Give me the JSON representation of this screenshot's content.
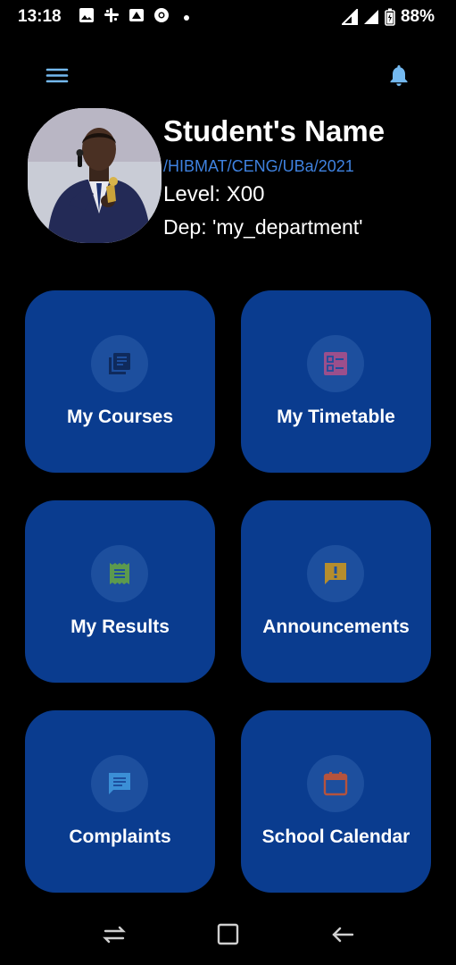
{
  "status_bar": {
    "time": "13:18",
    "battery": "88%",
    "left_icons": [
      "image-icon",
      "slack-icon",
      "app-icon",
      "chrome-icon"
    ],
    "right_icons": [
      "signal-icon",
      "signal-icon",
      "battery-icon"
    ]
  },
  "header": {
    "menu_icon": "hamburger-menu-icon",
    "bell_icon": "notification-bell-icon",
    "accent_color": "#74b9f0"
  },
  "profile": {
    "name": "Student's Name",
    "reg_no": "/HIBMAT/CENG/UBa/2021",
    "level": "Level: X00",
    "department": "Dep: 'my_department'"
  },
  "dashboard": {
    "card_color": "#0a3c8f",
    "items": [
      {
        "label": "My Courses",
        "icon": "library-books-icon",
        "icon_color": "#0f2a5c"
      },
      {
        "label": "My Timetable",
        "icon": "checklist-icon",
        "icon_color": "#9b4f8c"
      },
      {
        "label": "My Results",
        "icon": "receipt-icon",
        "icon_color": "#5c9a4e"
      },
      {
        "label": "Announcements",
        "icon": "announcement-icon",
        "icon_color": "#b58d2d"
      },
      {
        "label": "Complaints",
        "icon": "chat-icon",
        "icon_color": "#3b8fd6"
      },
      {
        "label": "School Calendar",
        "icon": "calendar-icon",
        "icon_color": "#b5533d"
      }
    ]
  },
  "nav_bar": {
    "icons": [
      "recent-apps-icon",
      "home-icon",
      "back-icon"
    ]
  }
}
